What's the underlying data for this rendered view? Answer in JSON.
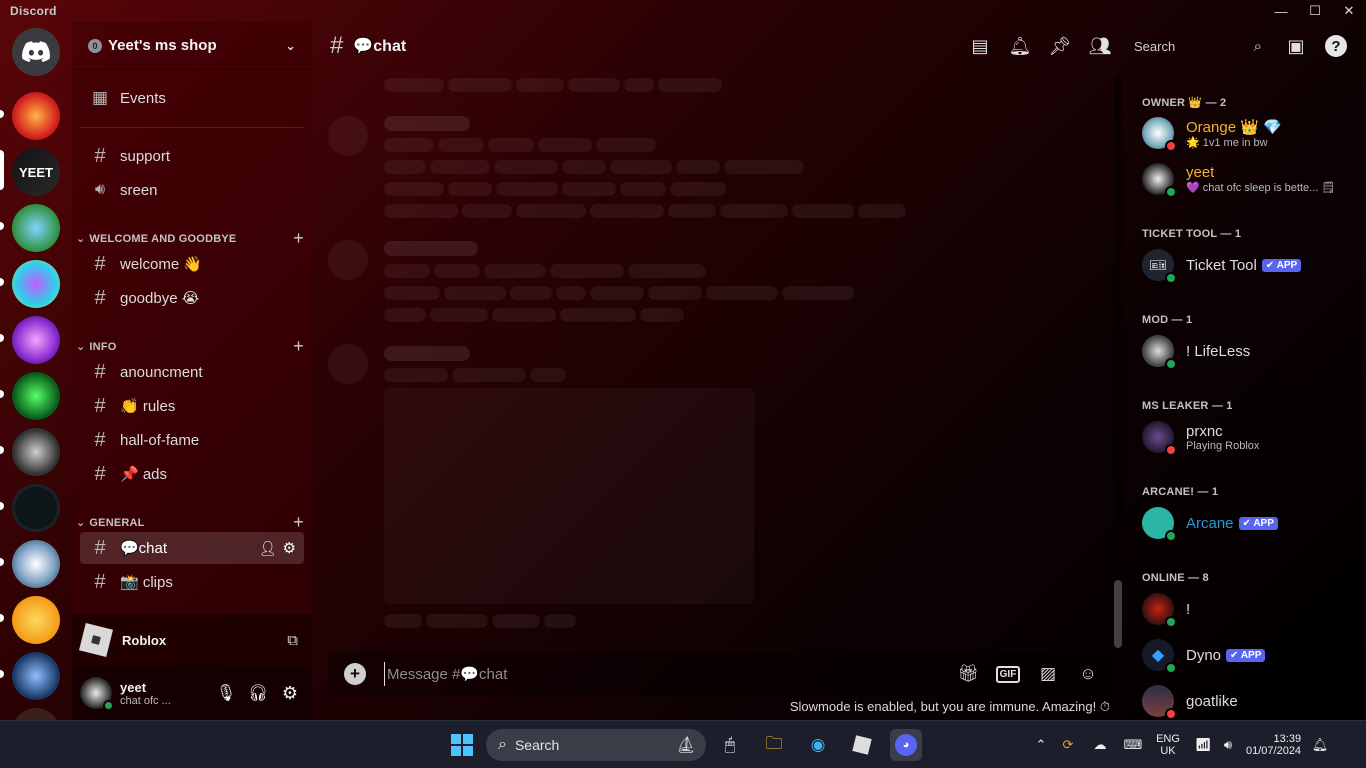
{
  "window": {
    "brand": "Discord",
    "minimize": "—",
    "maximize": "☐",
    "close": "✕"
  },
  "colors": {
    "accent": "#5865f2",
    "online": "#23a55a",
    "dnd": "#f23f43",
    "owner_name": "#f0b232",
    "app_name": "#1e9bd7"
  },
  "guild": {
    "tag": "0",
    "name": "Yeet's ms shop",
    "events_label": "Events"
  },
  "channels": {
    "support": "support",
    "sreen": "sreen",
    "categories": {
      "welcome": "WELCOME AND GOODBYE",
      "info": "INFO",
      "general": "GENERAL"
    },
    "welcome": "welcome 👋",
    "goodbye": "goodbye 😭",
    "anouncment": "anouncment",
    "rules": "👏 rules",
    "hall": "hall-of-fame",
    "ads": "📌 ads",
    "chat": "💬chat",
    "clips": "📸 clips"
  },
  "activity": {
    "game": "Roblox"
  },
  "user": {
    "name": "yeet",
    "status": "chat ofc ..."
  },
  "chat": {
    "title": "💬chat",
    "search_label": "Search",
    "composer_placeholder": "Message #💬chat",
    "slowmode": "Slowmode is enabled, but you are immune. Amazing! ⏱"
  },
  "members": {
    "owner_cat": "OWNER 👑 — 2",
    "orange": {
      "name": "Orange 👑 💎",
      "status": "🌟 1v1 me in bw"
    },
    "yeet": {
      "name": "yeet",
      "status": "💜 chat ofc sleep is bette... 🗒"
    },
    "ticket_cat": "TICKET TOOL — 1",
    "ticket": {
      "name": "Ticket Tool",
      "badge": "✔ APP"
    },
    "mod_cat": "MOD — 1",
    "lifeless": {
      "name": "! LifeLess"
    },
    "leaker_cat": "MS LEAKER — 1",
    "prxnc": {
      "name": "prxnc",
      "status": "Playing Roblox"
    },
    "arcane_cat": "ARCANE! — 1",
    "arcane": {
      "name": "Arcane",
      "badge": "✔ APP"
    },
    "online_cat": "ONLINE — 8",
    "bang": {
      "name": "!"
    },
    "dyno": {
      "name": "Dyno",
      "badge": "✔ APP"
    },
    "goatlike": {
      "name": "goatlike"
    }
  },
  "taskbar": {
    "search": "Search",
    "lang1": "ENG",
    "lang2": "UK",
    "time": "13:39",
    "date": "01/07/2024"
  }
}
